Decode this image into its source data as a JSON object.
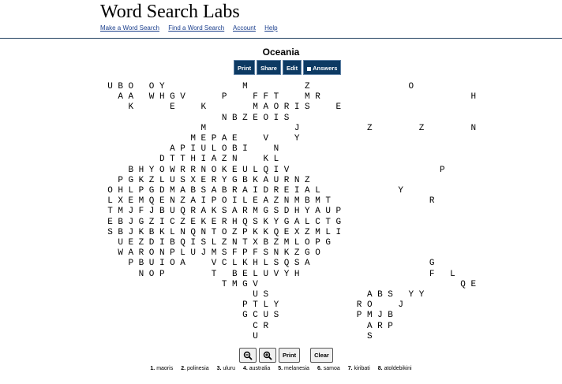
{
  "site": {
    "title": "Word Search Labs",
    "nav": [
      "Make a Word Search",
      "Find a Word Search",
      "Account",
      "Help"
    ]
  },
  "puzzle": {
    "title": "Oceania"
  },
  "toolbar": {
    "print": "Print",
    "share": "Share",
    "edit": "Edit",
    "answers": "Answers"
  },
  "grid_rows": [
    "UBO OY       M     Z         O       ",
    " AA WHGV   P  FFT  MR              H ",
    "  K   E  K    MAORIS  E              ",
    "           NBZEOIS                   ",
    "         M        J      Z    Z    N",
    "        MEPAE  V  Y                  ",
    "      APIULOBI  N                    ",
    "     DTTHIAZN  KL                    ",
    "  BHYOWRRNOKEULQIV              P    ",
    " PGKZLUSXERYGBKAURNZ                 ",
    "OHLPGDMABSABRAIDREIAL       Y        ",
    "LXEMQENZAIPOILEAZNMBMT         R     ",
    "TMJFJBUQRAKSARMGSDHYAUP              ",
    "EBJGZICZEKERHQSKYGALCTG              ",
    "SBJKBKLNQNTOZPKKQEXZMLI              ",
    " UEZDIBQISLZNTXBZMLOPG               ",
    " WARONPLUJMSFPFSNKZGO                ",
    "  PBUIOA  VCLKHLSQSA           G     ",
    "   NOP    T BELUVYH            F L   ",
    "           TMGV                   QE ",
    "              US         ABS YY      ",
    "             PTLY       RO  J        ",
    "             GCUS       PMJB         ",
    "              CR         ARP         ",
    "              U          S           "
  ],
  "bottom_bar": {
    "zoom_out": "zoom-out",
    "zoom_in": "zoom-in",
    "print": "Print",
    "clear": "Clear"
  },
  "words": [
    {
      "num": "1.",
      "word": "maoris"
    },
    {
      "num": "2.",
      "word": "polinesia"
    },
    {
      "num": "3.",
      "word": "uluru"
    },
    {
      "num": "4.",
      "word": "australia"
    },
    {
      "num": "5.",
      "word": "melanesia"
    },
    {
      "num": "6.",
      "word": "samoa"
    },
    {
      "num": "7.",
      "word": "kiribati"
    },
    {
      "num": "8.",
      "word": "atoldebikini"
    }
  ],
  "colors": {
    "header_rule": "#1f3f5f",
    "toolbar_bg": "#0d3a63",
    "link": "#1a3e8c"
  }
}
